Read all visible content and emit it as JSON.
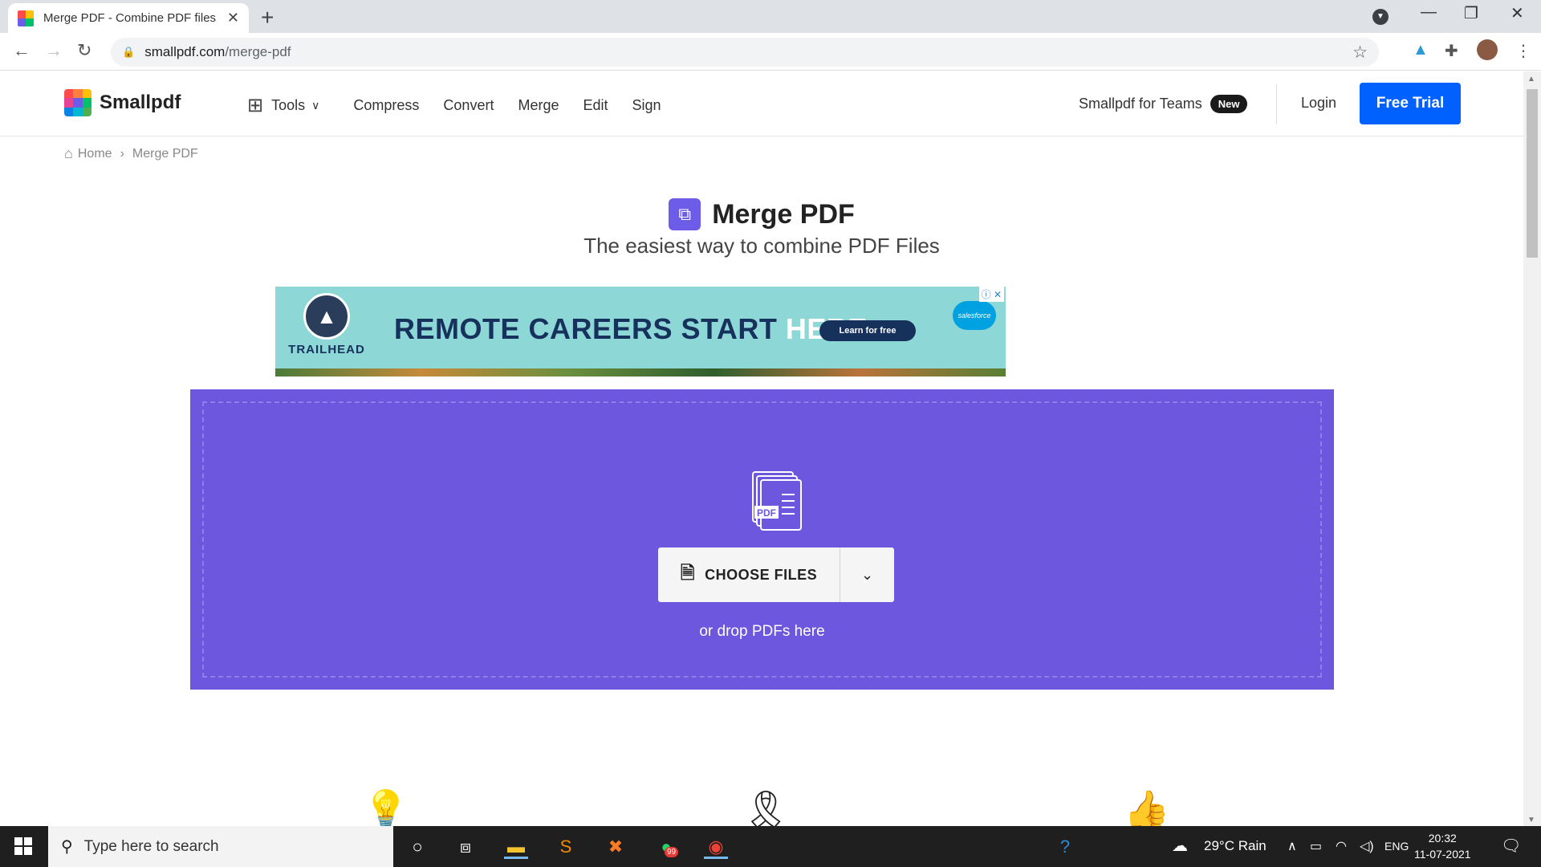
{
  "browser": {
    "tab_title": "Merge PDF - Combine PDF files o",
    "url_domain": "smallpdf.com",
    "url_path": "/merge-pdf"
  },
  "header": {
    "brand": "Smallpdf",
    "tools_label": "Tools",
    "nav": [
      "Compress",
      "Convert",
      "Merge",
      "Edit",
      "Sign"
    ],
    "teams_label": "Smallpdf for Teams",
    "teams_badge": "New",
    "login_label": "Login",
    "trial_label": "Free Trial"
  },
  "breadcrumb": {
    "home": "Home",
    "separator": "›",
    "current": "Merge PDF"
  },
  "hero": {
    "title": "Merge PDF",
    "subtitle": "The easiest way to combine PDF Files"
  },
  "ad": {
    "brand": "TRAILHEAD",
    "headline_main": "REMOTE CAREERS START ",
    "headline_highlight": "HERE.",
    "cta": "Learn for free",
    "sponsor": "salesforce"
  },
  "dropzone": {
    "illustration_label": "PDF",
    "choose_label": "CHOOSE FILES",
    "drop_text": "or drop PDFs here"
  },
  "taskbar": {
    "search_placeholder": "Type here to search",
    "whatsapp_badge": "99",
    "weather": "29°C  Rain",
    "language": "ENG",
    "time": "20:32",
    "date": "11-07-2021"
  },
  "colors": {
    "accent": "#0061fe",
    "dropzone": "#6c57de",
    "merge_icon": "#6c5ce7"
  }
}
